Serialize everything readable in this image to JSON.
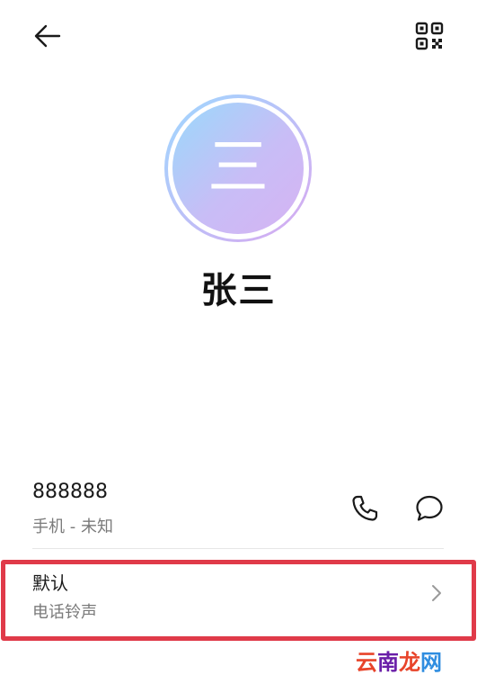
{
  "header": {
    "back_icon": "arrow-left-icon",
    "qr_icon": "qr-code-icon"
  },
  "contact": {
    "avatar_initial": "三",
    "name": "张三",
    "avatar_colors": [
      "#9ad9fb",
      "#d6b3f3"
    ]
  },
  "phone": {
    "number": "888888",
    "meta": "手机 - 未知",
    "call_icon": "phone-icon",
    "message_icon": "message-bubble-icon"
  },
  "ringtone": {
    "title": "默认",
    "subtitle": "电话铃声",
    "chevron_icon": "chevron-right-icon"
  },
  "watermark": {
    "parts": [
      "云",
      "南",
      "龙",
      "网"
    ]
  },
  "colors": {
    "highlight": "#e03a49",
    "secondary_text": "#7a7a7a",
    "divider": "#e6e6e6"
  }
}
